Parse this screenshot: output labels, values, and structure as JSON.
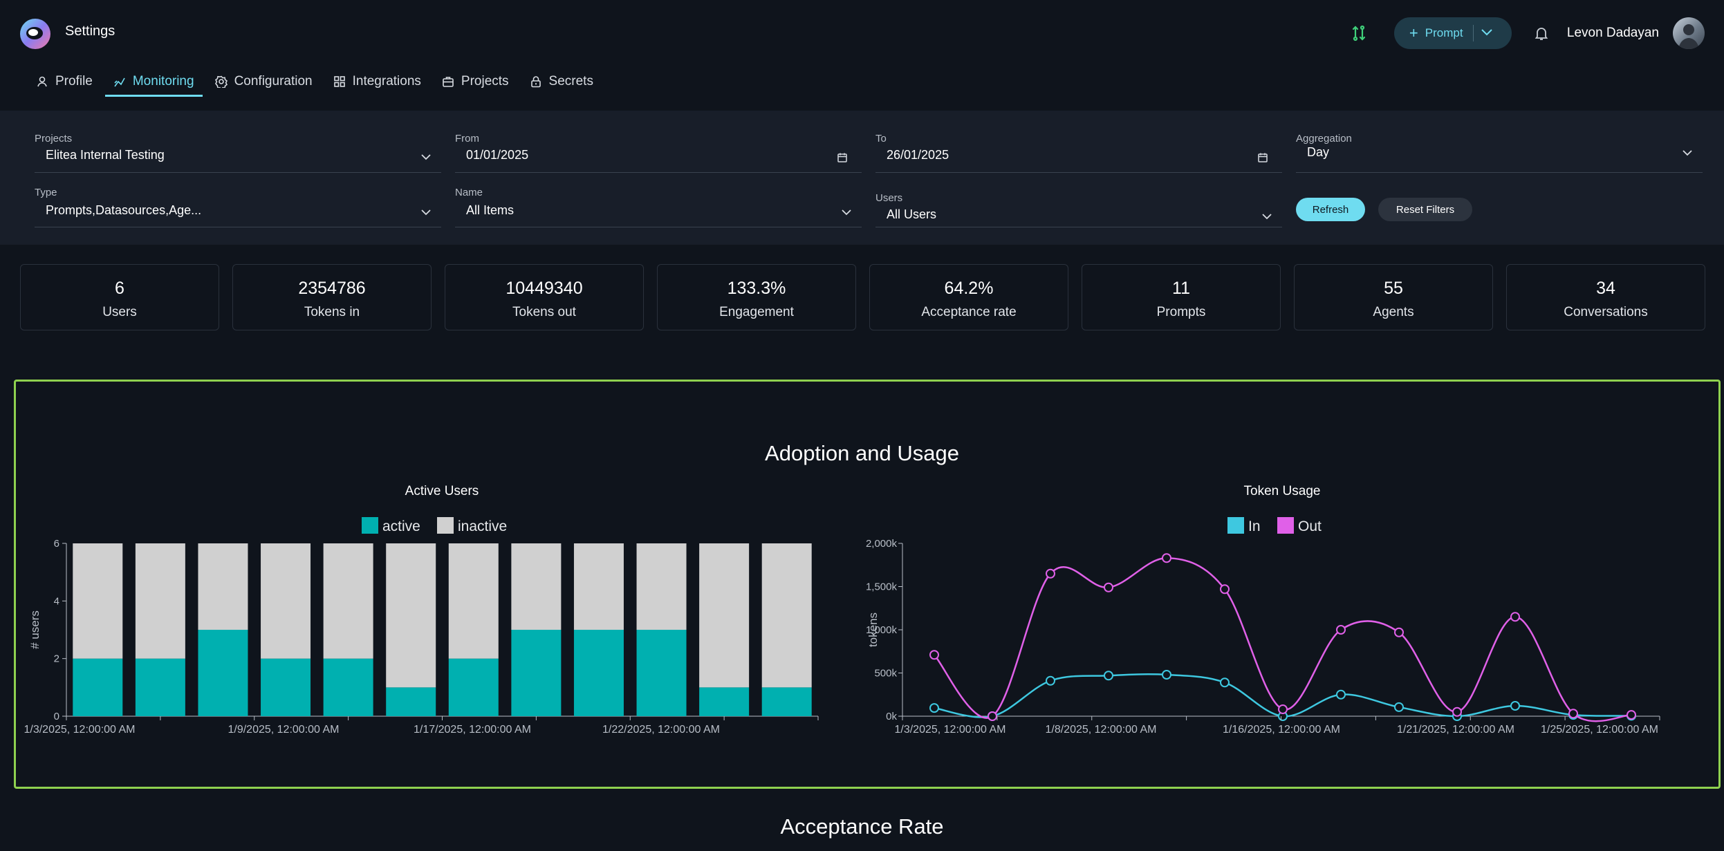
{
  "app": {
    "title": "Settings",
    "user_name": "Levon Dadayan",
    "prompt_button_label": "Prompt",
    "icons": {
      "logo": "elitea-logo-icon",
      "sync": "sync-icon",
      "bell": "bell-icon",
      "chevron": "chevron-down-icon"
    }
  },
  "tabs": [
    {
      "label": "Profile",
      "icon": "user-icon",
      "active": false
    },
    {
      "label": "Monitoring",
      "icon": "chart-line-icon",
      "active": true
    },
    {
      "label": "Configuration",
      "icon": "gear-icon",
      "active": false
    },
    {
      "label": "Integrations",
      "icon": "grid-icon",
      "active": false
    },
    {
      "label": "Projects",
      "icon": "briefcase-icon",
      "active": false
    },
    {
      "label": "Secrets",
      "icon": "lock-icon",
      "active": false
    }
  ],
  "filters": {
    "projects": {
      "label": "Projects",
      "value": "Elitea Internal Testing"
    },
    "from": {
      "label": "From",
      "value": "01/01/2025"
    },
    "to": {
      "label": "To",
      "value": "26/01/2025"
    },
    "aggregation": {
      "label": "Aggregation",
      "value": "Day"
    },
    "type": {
      "label": "Type",
      "value": "Prompts,Datasources,Age..."
    },
    "name": {
      "label": "Name",
      "value": "All Items"
    },
    "users": {
      "label": "Users",
      "value": "All Users"
    },
    "refresh_label": "Refresh",
    "reset_label": "Reset Filters"
  },
  "stats": [
    {
      "value": "6",
      "label": "Users"
    },
    {
      "value": "2354786",
      "label": "Tokens in"
    },
    {
      "value": "10449340",
      "label": "Tokens out"
    },
    {
      "value": "133.3%",
      "label": "Engagement"
    },
    {
      "value": "64.2%",
      "label": "Acceptance rate"
    },
    {
      "value": "11",
      "label": "Prompts"
    },
    {
      "value": "55",
      "label": "Agents"
    },
    {
      "value": "34",
      "label": "Conversations"
    }
  ],
  "sections": {
    "adoption_title": "Adoption and Usage",
    "acceptance_title": "Acceptance Rate"
  },
  "colors": {
    "accent": "#6fdcf0",
    "active": "#00b0b0",
    "inactive": "#d0d0d0",
    "token_in": "#3ec8e0",
    "token_out": "#e060e8",
    "panel_border": "#8fd14f"
  },
  "chart_data": [
    {
      "type": "bar",
      "title": "Active Users",
      "ylabel": "# users",
      "ylim": [
        0,
        6
      ],
      "yticks": [
        0,
        2,
        4,
        6
      ],
      "x_tick_labels": [
        "1/3/2025, 12:00:00 AM",
        "1/9/2025, 12:00:00 AM",
        "1/17/2025, 12:00:00 AM",
        "1/22/2025, 12:00:00 AM"
      ],
      "stacked": true,
      "series": [
        {
          "name": "active",
          "values": [
            2,
            2,
            3,
            2,
            2,
            1,
            2,
            3,
            3,
            3,
            1,
            1
          ]
        },
        {
          "name": "inactive",
          "values": [
            4,
            4,
            3,
            4,
            4,
            5,
            4,
            3,
            3,
            3,
            5,
            5
          ]
        }
      ],
      "legend": "top-center",
      "grid": false
    },
    {
      "type": "line",
      "title": "Token Usage",
      "ylabel": "tokens",
      "ylim": [
        0,
        2000000
      ],
      "ytick_labels": [
        "0k",
        "500k",
        "1,000k",
        "1,500k",
        "2,000k"
      ],
      "yticks": [
        0,
        500000,
        1000000,
        1500000,
        2000000
      ],
      "x_tick_labels": [
        "1/3/2025, 12:00:00 AM",
        "1/8/2025, 12:00:00 AM",
        "1/16/2025, 12:00:00 AM",
        "1/21/2025, 12:00:00 AM",
        "1/25/2025, 12:00:00 AM"
      ],
      "series": [
        {
          "name": "In",
          "values": [
            95000,
            0,
            410000,
            470000,
            480000,
            390000,
            0,
            250000,
            105000,
            0,
            120000,
            15000,
            5000
          ]
        },
        {
          "name": "Out",
          "values": [
            710000,
            0,
            1650000,
            1490000,
            1830000,
            1470000,
            80000,
            1000000,
            970000,
            50000,
            1150000,
            30000,
            15000
          ]
        }
      ],
      "legend": "top-center",
      "grid": false
    }
  ]
}
